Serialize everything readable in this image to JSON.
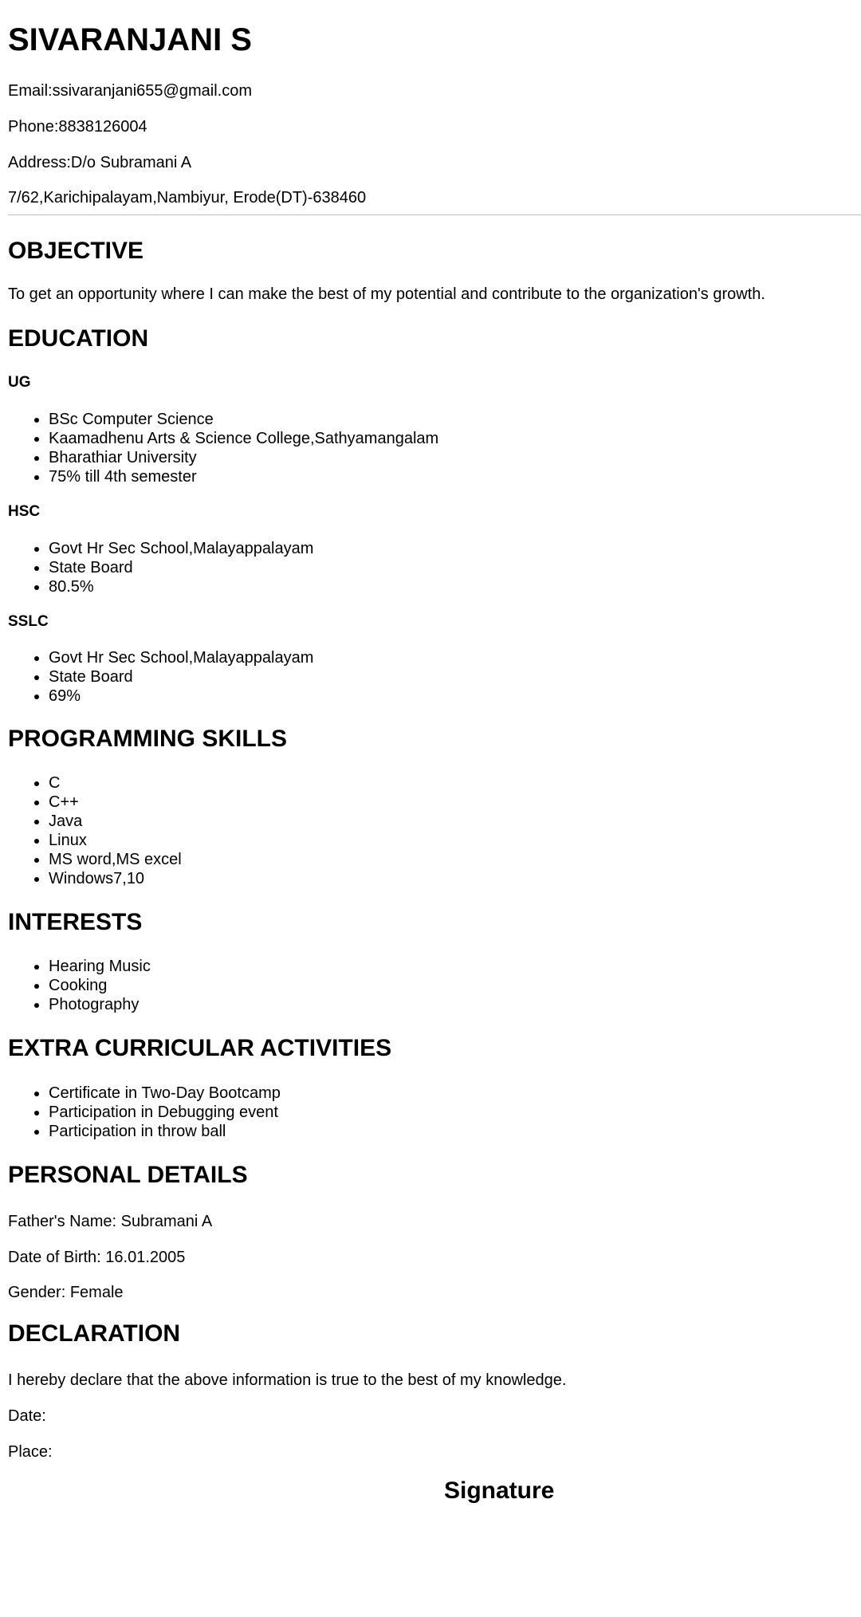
{
  "header": {
    "name": "SIVARANJANI S",
    "email": "Email:ssivaranjani655@gmail.com",
    "phone": "Phone:8838126004",
    "address_line1": "Address:D/o Subramani A",
    "address_line2": "7/62,Karichipalayam,Nambiyur, Erode(DT)-638460"
  },
  "objective": {
    "heading": "OBJECTIVE",
    "text": "To get an opportunity where I can make the best of my potential and contribute to the organization's growth."
  },
  "education": {
    "heading": "EDUCATION",
    "ug": {
      "heading": "UG",
      "items": [
        "BSc Computer Science",
        "Kaamadhenu Arts & Science College,Sathyamangalam",
        "Bharathiar University",
        "75% till 4th semester"
      ]
    },
    "hsc": {
      "heading": "HSC",
      "items": [
        "Govt Hr Sec School,Malayappalayam",
        "State Board",
        "80.5%"
      ]
    },
    "sslc": {
      "heading": "SSLC",
      "items": [
        "Govt Hr Sec School,Malayappalayam",
        "State Board",
        "69%"
      ]
    }
  },
  "skills": {
    "heading": "PROGRAMMING SKILLS",
    "items": [
      "C",
      "C++",
      "Java",
      "Linux",
      "MS word,MS excel",
      "Windows7,10"
    ]
  },
  "interests": {
    "heading": "INTERESTS",
    "items": [
      "Hearing Music",
      "Cooking",
      "Photography"
    ]
  },
  "extracurricular": {
    "heading": "EXTRA CURRICULAR ACTIVITIES",
    "items": [
      "Certificate in Two-Day Bootcamp",
      "Participation in Debugging event",
      "Participation in throw ball"
    ]
  },
  "personal": {
    "heading": "PERSONAL DETAILS",
    "father": "Father's Name: Subramani A",
    "dob": "Date of Birth: 16.01.2005",
    "gender": "Gender: Female"
  },
  "declaration": {
    "heading": "DECLARATION",
    "text": "I hereby declare that the above information is true to the best of my knowledge.",
    "date": "Date:",
    "place": "Place:",
    "signature": "Signature"
  }
}
